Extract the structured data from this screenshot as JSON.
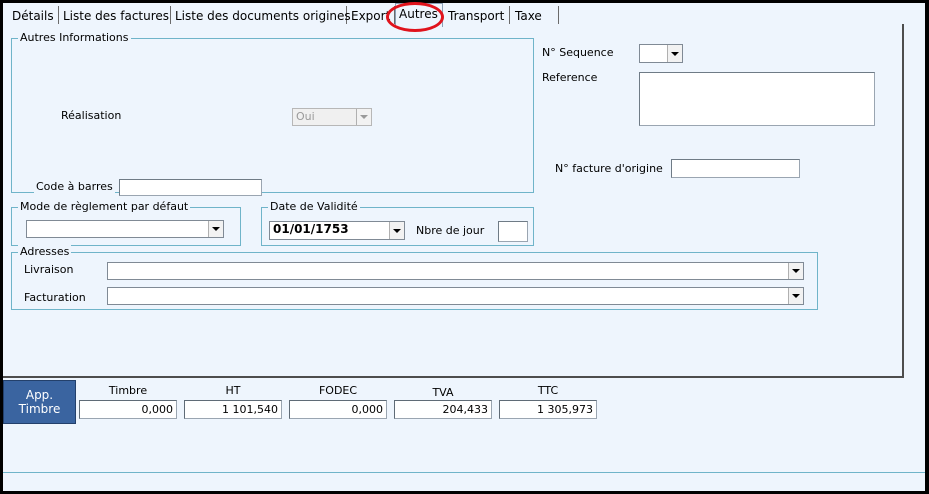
{
  "tabs": [
    "Détails",
    "Liste des factures",
    "Liste des documents origines",
    "Export",
    "Autres",
    "Transport",
    "Taxe"
  ],
  "active_tab": "Autres",
  "autres_info": {
    "legend": "Autres Informations",
    "realisation_label": "Réalisation",
    "realisation_value": "Oui",
    "code_barres_label": "Code à barres",
    "code_barres_value": ""
  },
  "right": {
    "sequence_label": "N° Sequence",
    "sequence_value": "",
    "reference_label": "Reference",
    "reference_value": "",
    "facture_origine_label": "N° facture d'origine",
    "facture_origine_value": ""
  },
  "mode_reglement": {
    "legend": "Mode de règlement par défaut",
    "value": ""
  },
  "date_validite": {
    "legend": "Date de Validité",
    "date_value": "01/01/1753",
    "nbre_jour_label": "Nbre de jour",
    "nbre_jour_value": ""
  },
  "adresses": {
    "legend": "Adresses",
    "livraison_label": "Livraison",
    "livraison_value": "",
    "facturation_label": "Facturation",
    "facturation_value": ""
  },
  "totals": {
    "button_line1": "App.",
    "button_line2": "Timbre",
    "items": [
      {
        "label": "Timbre",
        "value": "0,000"
      },
      {
        "label": "HT",
        "value": "1 101,540"
      },
      {
        "label": "FODEC",
        "value": "0,000"
      },
      {
        "label": "TVA",
        "value": "204,433"
      },
      {
        "label": "TTC",
        "value": "1 305,973"
      }
    ]
  },
  "colors": {
    "background": "#eef5fd",
    "group_border": "#6fb4c9",
    "button": "#3a64a0",
    "highlight_circle": "#e0131c"
  },
  "icons": [
    "dropdown-arrow-icon"
  ]
}
